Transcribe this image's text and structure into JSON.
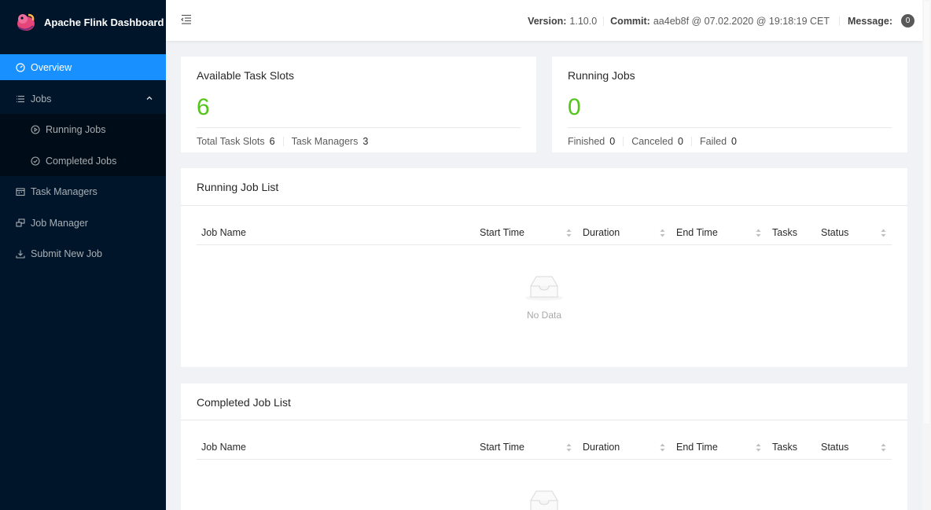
{
  "app": {
    "title": "Apache Flink Dashboard"
  },
  "sidebar": {
    "items": [
      {
        "label": "Overview",
        "icon": "dashboard-icon"
      },
      {
        "label": "Jobs",
        "icon": "bars-icon"
      },
      {
        "label": "Running Jobs",
        "icon": "play-circle-icon"
      },
      {
        "label": "Completed Jobs",
        "icon": "check-circle-icon"
      },
      {
        "label": "Task Managers",
        "icon": "schedule-icon"
      },
      {
        "label": "Job Manager",
        "icon": "cluster-icon"
      },
      {
        "label": "Submit New Job",
        "icon": "upload-icon"
      }
    ]
  },
  "header": {
    "version_label": "Version:",
    "version_value": "1.10.0",
    "commit_label": "Commit:",
    "commit_value": "aa4eb8f @ 07.02.2020 @ 19:18:19 CET",
    "message_label": "Message:",
    "message_count": "0"
  },
  "slots_card": {
    "title": "Available Task Slots",
    "value": "6",
    "total_label": "Total Task Slots",
    "total_value": "6",
    "tm_label": "Task Managers",
    "tm_value": "3"
  },
  "jobs_card": {
    "title": "Running Jobs",
    "value": "0",
    "finished_label": "Finished",
    "finished_value": "0",
    "canceled_label": "Canceled",
    "canceled_value": "0",
    "failed_label": "Failed",
    "failed_value": "0"
  },
  "running_list": {
    "title": "Running Job List",
    "columns": [
      "Job Name",
      "Start Time",
      "Duration",
      "End Time",
      "Tasks",
      "Status"
    ],
    "empty_text": "No Data"
  },
  "completed_list": {
    "title": "Completed Job List",
    "columns": [
      "Job Name",
      "Start Time",
      "Duration",
      "End Time",
      "Tasks",
      "Status"
    ]
  },
  "colors": {
    "sidebar": "#001529",
    "accent": "#1890ff",
    "success": "#52c41a"
  }
}
